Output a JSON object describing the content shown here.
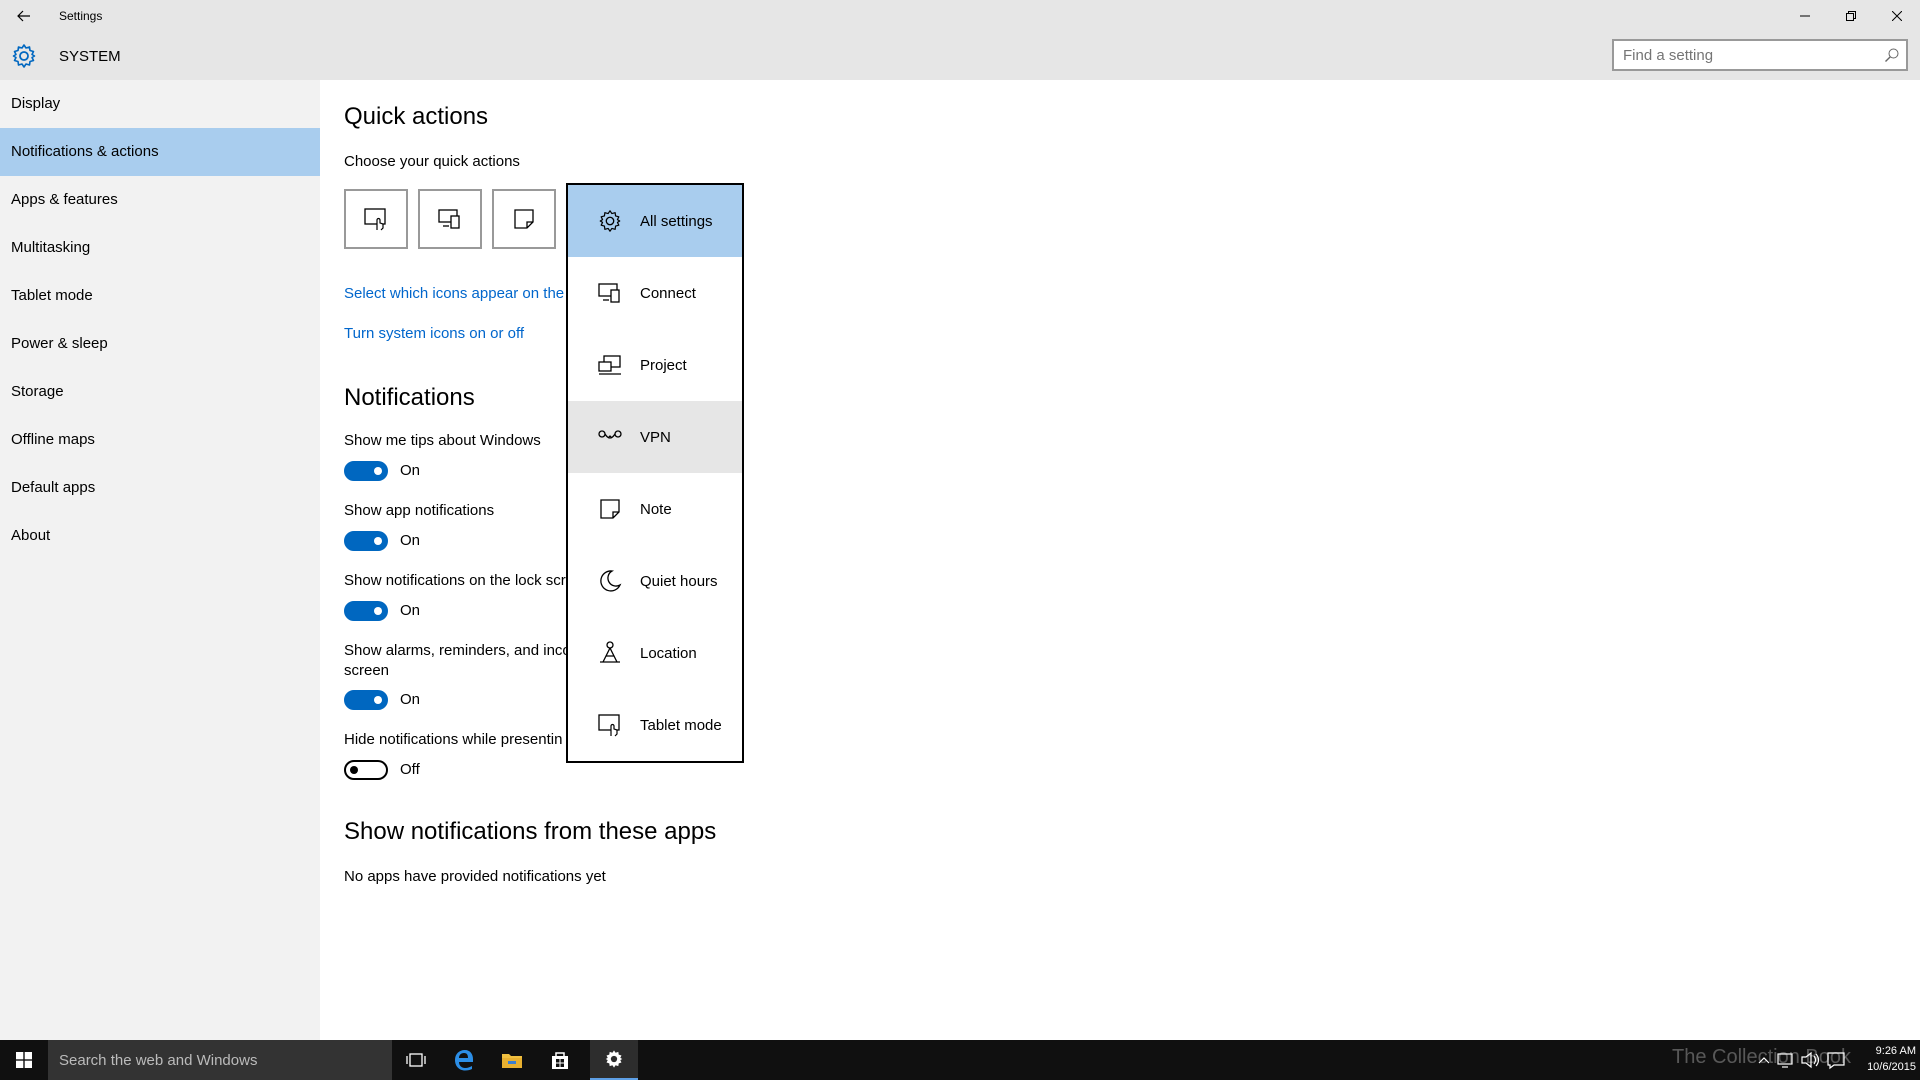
{
  "window": {
    "title": "Settings",
    "header": "SYSTEM",
    "search_placeholder": "Find a setting"
  },
  "sidebar": {
    "items": [
      {
        "label": "Display"
      },
      {
        "label": "Notifications & actions"
      },
      {
        "label": "Apps & features"
      },
      {
        "label": "Multitasking"
      },
      {
        "label": "Tablet mode"
      },
      {
        "label": "Power & sleep"
      },
      {
        "label": "Storage"
      },
      {
        "label": "Offline maps"
      },
      {
        "label": "Default apps"
      },
      {
        "label": "About"
      }
    ],
    "active_index": 1
  },
  "quick_actions": {
    "heading": "Quick actions",
    "subheading": "Choose your quick actions",
    "link_icons": "Select which icons appear on the",
    "link_system": "Turn system icons on or off"
  },
  "notifications": {
    "heading": "Notifications",
    "settings": [
      {
        "label": "Show me tips about Windows",
        "state": "On"
      },
      {
        "label": "Show app notifications",
        "state": "On"
      },
      {
        "label": "Show notifications on the lock scr",
        "state": "On"
      },
      {
        "label": "Show alarms, reminders, and inco",
        "label2": "screen",
        "state": "On"
      },
      {
        "label": "Hide notifications while presentin",
        "state": "Off"
      }
    ]
  },
  "apps_section": {
    "heading": "Show notifications from these apps",
    "empty_text": "No apps have provided notifications yet"
  },
  "popup": {
    "items": [
      {
        "label": "All settings",
        "icon": "gear-icon"
      },
      {
        "label": "Connect",
        "icon": "connect-icon"
      },
      {
        "label": "Project",
        "icon": "project-icon"
      },
      {
        "label": "VPN",
        "icon": "vpn-icon"
      },
      {
        "label": "Note",
        "icon": "note-icon"
      },
      {
        "label": "Quiet hours",
        "icon": "moon-icon"
      },
      {
        "label": "Location",
        "icon": "location-icon"
      },
      {
        "label": "Tablet mode",
        "icon": "tablet-mode-icon"
      }
    ],
    "selected": "All settings",
    "hovered": "VPN"
  },
  "taskbar": {
    "search_placeholder": "Search the web and Windows",
    "time": "9:26 AM",
    "date": "10/6/2015",
    "watermark": "The Collection Book"
  },
  "colors": {
    "accent": "#0067c0",
    "selection": "#a9cdee",
    "link": "#0066cc"
  }
}
